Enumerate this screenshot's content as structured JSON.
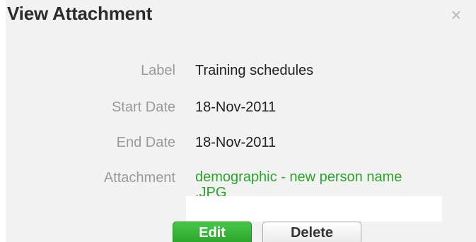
{
  "dialog": {
    "title": "View Attachment",
    "close_symbol": "×"
  },
  "fields": {
    "label": {
      "name": "Label",
      "value": "Training schedules"
    },
    "start_date": {
      "name": "Start Date",
      "value": "18-Nov-2011"
    },
    "end_date": {
      "name": "End Date",
      "value": "18-Nov-2011"
    },
    "attachment": {
      "name": "Attachment",
      "value": "demographic - new person name .JPG"
    }
  },
  "buttons": {
    "edit": "Edit",
    "delete": "Delete"
  },
  "colors": {
    "link": "#2aa52a",
    "primary_button": "#2aa52a"
  }
}
